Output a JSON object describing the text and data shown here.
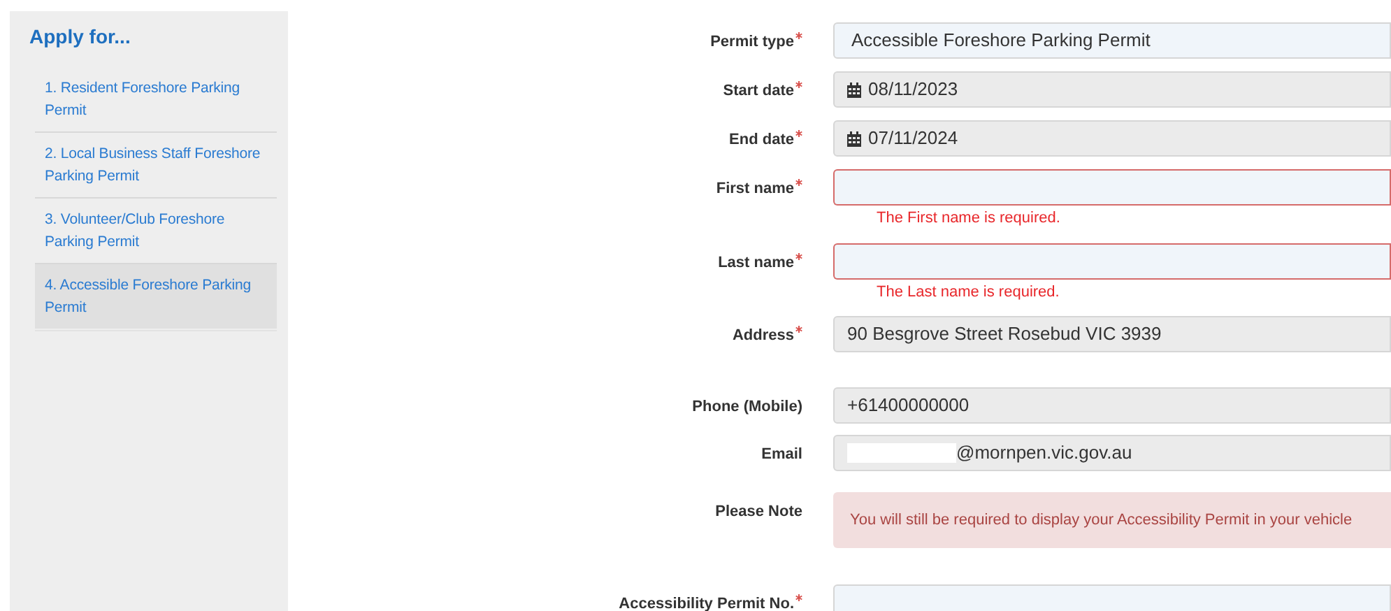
{
  "sidebar": {
    "title": "Apply for...",
    "items": [
      {
        "label": "1. Resident Foreshore Parking Permit",
        "selected": false
      },
      {
        "label": "2. Local Business Staff Foreshore Parking Permit",
        "selected": false
      },
      {
        "label": "3. Volunteer/Club Foreshore Parking Permit",
        "selected": false
      },
      {
        "label": "4. Accessible Foreshore Parking Permit",
        "selected": true
      }
    ]
  },
  "form": {
    "fields": [
      {
        "kind": "text",
        "label": "Permit type",
        "required": true,
        "value": "Accessible Foreshore Parking Permit",
        "readonly": false,
        "invalid": false
      },
      {
        "kind": "date",
        "label": "Start date",
        "required": true,
        "value": "08/11/2023",
        "readonly": true,
        "invalid": false
      },
      {
        "kind": "date",
        "label": "End date",
        "required": true,
        "value": "07/11/2024",
        "readonly": true,
        "invalid": false
      },
      {
        "kind": "text",
        "label": "First name",
        "required": true,
        "readonly": false,
        "invalid": true,
        "error": "The First name is required."
      },
      {
        "kind": "text",
        "label": "Last name",
        "required": true,
        "readonly": false,
        "invalid": true,
        "error": "The Last name is required."
      },
      {
        "kind": "text",
        "label": "Address",
        "required": true,
        "value": "90 Besgrove Street Rosebud VIC 3939",
        "readonly": true,
        "invalid": false
      },
      {
        "kind": "text",
        "label": "Phone (Mobile)",
        "required": false,
        "value": "+61400000000",
        "readonly": true,
        "invalid": false
      },
      {
        "kind": "redacted",
        "label": "Email",
        "required": false,
        "value": "@mornpen.vic.gov.au",
        "readonly": true,
        "invalid": false
      },
      {
        "kind": "note",
        "label": "Please Note",
        "required": false,
        "value": "You will still be required to display your Accessibility Permit in your vehicle"
      },
      {
        "kind": "text",
        "label": "Accessibility Permit No.",
        "required": true,
        "readonly": false,
        "invalid": false
      }
    ]
  }
}
